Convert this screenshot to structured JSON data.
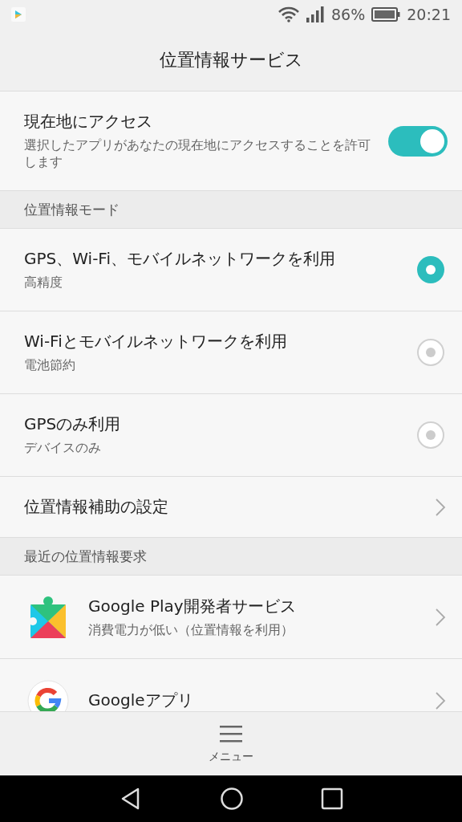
{
  "status_bar": {
    "battery": "86%",
    "time": "20:21"
  },
  "title": "位置情報サービス",
  "items": [
    {
      "kind": "toggle",
      "title": "現在地にアクセス",
      "subtitle": "選択したアプリがあなたの現在地にアクセスすることを許可します",
      "on": true
    },
    {
      "kind": "header",
      "title": "位置情報モード"
    },
    {
      "kind": "radio",
      "title": "GPS、Wi-Fi、モバイルネットワークを利用",
      "subtitle": "高精度",
      "selected": true
    },
    {
      "kind": "radio",
      "title": "Wi-Fiとモバイルネットワークを利用",
      "subtitle": "電池節約",
      "selected": false
    },
    {
      "kind": "radio",
      "title": "GPSのみ利用",
      "subtitle": "デバイスのみ",
      "selected": false
    },
    {
      "kind": "link",
      "title": "位置情報補助の設定"
    },
    {
      "kind": "header",
      "title": "最近の位置情報要求"
    },
    {
      "kind": "app",
      "title": "Google Play開発者サービス",
      "subtitle": "消費電力が低い（位置情報を利用）"
    },
    {
      "kind": "app",
      "title": "Googleアプリ"
    }
  ],
  "menu": {
    "label": "メニュー"
  }
}
